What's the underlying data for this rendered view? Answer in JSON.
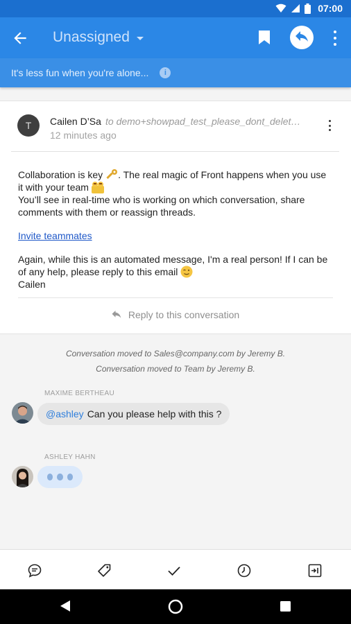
{
  "status_bar": {
    "time": "07:00"
  },
  "app_bar": {
    "title": "Unassigned"
  },
  "banner": {
    "text": "It's less fun when you're alone...",
    "info_icon_glyph": "i"
  },
  "message": {
    "avatar_letter": "T",
    "sender": "Cailen D’Sa",
    "recipient": "to demo+showpad_test_please_dont_delete@frontapp.com",
    "time": "12 minutes ago",
    "body": {
      "line1_a": "Collaboration is key ",
      "line1_b": ". The real magic of Front happens when you use it with your team ",
      "line2": "You’ll see in real-time who is working on which conversation, share comments with them or reassign threads.",
      "link": "Invite teammates",
      "line3": "Again, while this is an automated message, I'm a real person! If I can be of any help, please reply to this email ",
      "signature": "Cailen"
    },
    "reply_label": "Reply to this conversation"
  },
  "activity": {
    "events": [
      "Conversation moved to Sales@company.com by Jeremy B.",
      "Conversation moved to Team by Jeremy B."
    ],
    "comments": [
      {
        "author": "MAXIME BERTHEAU",
        "mention": "@ashley",
        "text": "Can you please help with this ?"
      },
      {
        "author": "ASHLEY HAHN",
        "typing": true
      }
    ]
  },
  "bottom_bar": {
    "icons": [
      "comment-icon",
      "tag-icon",
      "check-icon",
      "snooze-clock-icon",
      "assign-icon"
    ]
  },
  "colors": {
    "primary": "#2b87e6",
    "status_bar": "#1b6fcf",
    "link": "#1f58c8",
    "mention": "#2f7fdc"
  }
}
